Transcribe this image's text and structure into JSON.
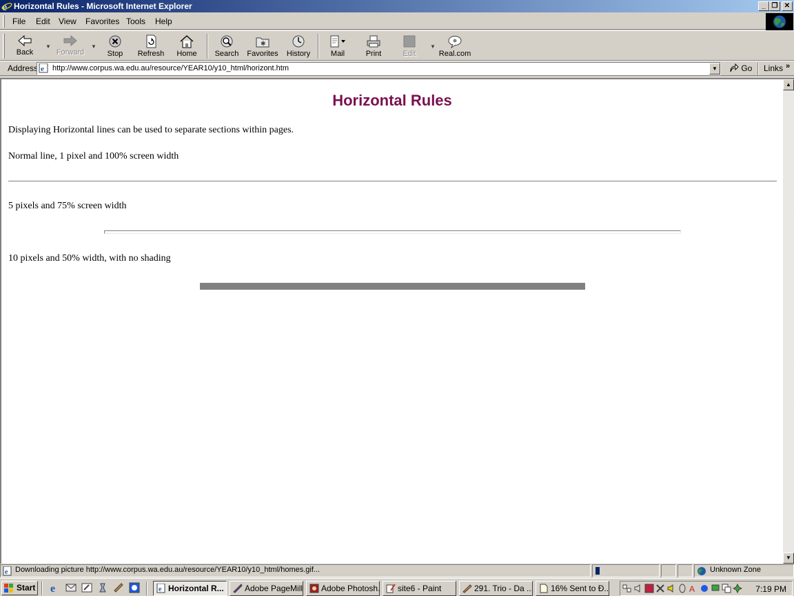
{
  "window": {
    "title": "Horizontal Rules - Microsoft Internet Explorer",
    "minimize": "_",
    "restore": "❐",
    "close": "✕"
  },
  "menu": {
    "file": "File",
    "edit": "Edit",
    "view": "View",
    "favorites": "Favorites",
    "tools": "Tools",
    "help": "Help"
  },
  "toolbar": {
    "back": "Back",
    "forward": "Forward",
    "stop": "Stop",
    "refresh": "Refresh",
    "home": "Home",
    "search": "Search",
    "favorites": "Favorites",
    "history": "History",
    "mail": "Mail",
    "print": "Print",
    "edit": "Edit",
    "realcom": "Real.com"
  },
  "address": {
    "label": "Address",
    "url": "http://www.corpus.wa.edu.au/resource/YEAR10/y10_html/horizont.htm",
    "go": "Go",
    "links": "Links"
  },
  "page": {
    "title": "Horizontal Rules",
    "intro": "Displaying Horizontal lines can be used to separate sections within pages.",
    "rule1_label": "Normal line, 1 pixel and 100% screen width",
    "rule2_label": "5 pixels and 75% screen width",
    "rule3_label": "10 pixels and 50% width, with no shading"
  },
  "status": {
    "text": "Downloading picture http://www.corpus.wa.edu.au/resource/YEAR10/y10_html/homes.gif...",
    "zone": "Unknown Zone"
  },
  "taskbar": {
    "start": "Start",
    "tasks": [
      {
        "label": "Horizontal R..."
      },
      {
        "label": "Adobe PageMill..."
      },
      {
        "label": "Adobe Photosh..."
      },
      {
        "label": "site6 - Paint"
      },
      {
        "label": "291. Trio - Da ..."
      },
      {
        "label": "16% Sent to Đ..."
      }
    ],
    "clock": "7:19 PM"
  },
  "colors": {
    "accent_title": "#7b1050",
    "titlebar_start": "#0a246a",
    "titlebar_end": "#a6caf0"
  }
}
